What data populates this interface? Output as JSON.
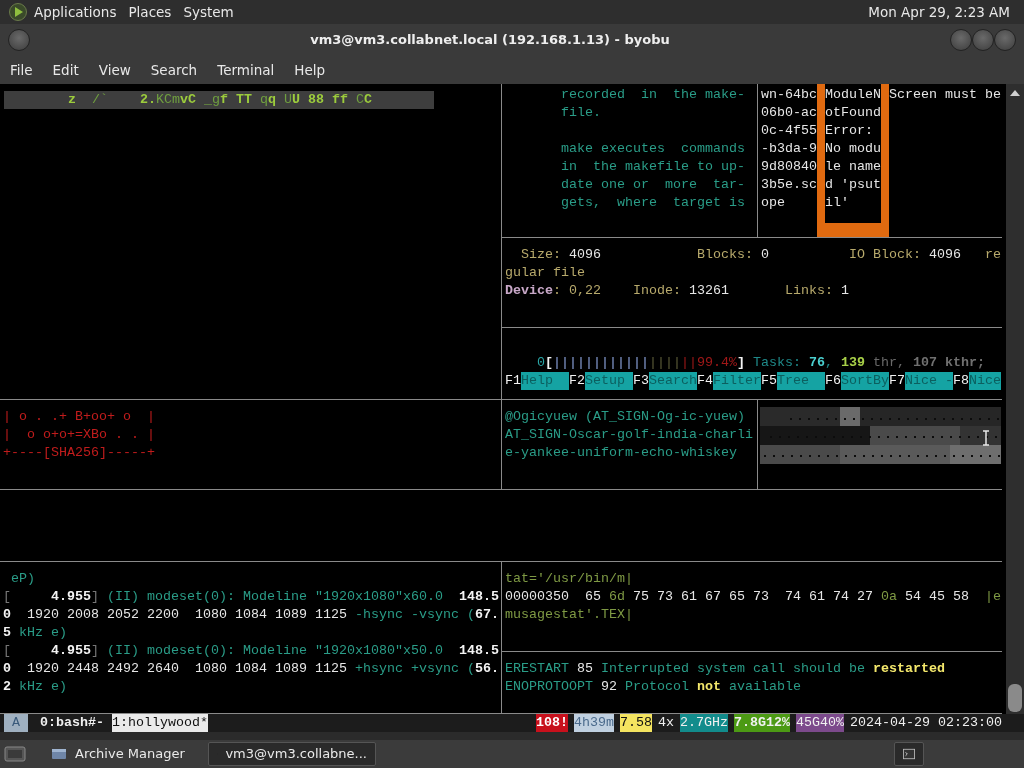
{
  "top_panel": {
    "menus": [
      "Applications",
      "Places",
      "System"
    ],
    "clock": "Mon Apr 29, 2:23 AM"
  },
  "window": {
    "title": "vm3@vm3.collabnet.local (192.168.1.13) - byobu",
    "menu": [
      "File",
      "Edit",
      "View",
      "Search",
      "Terminal",
      "Help"
    ]
  },
  "terminal": {
    "banner": [
      {
        "text": "        z",
        "kind": "bright"
      },
      {
        "text": "  /`",
        "kind": "dim"
      },
      {
        "text": "    2.",
        "kind": "bright"
      },
      {
        "text": "KCm",
        "kind": "dim"
      },
      {
        "text": "vC ",
        "kind": "bright"
      },
      {
        "text": "_g",
        "kind": "dim"
      },
      {
        "text": "f TT ",
        "kind": "bright"
      },
      {
        "text": "q",
        "kind": "dim"
      },
      {
        "text": "q ",
        "kind": "bright"
      },
      {
        "text": "U",
        "kind": "dim"
      },
      {
        "text": "U 88 ff ",
        "kind": "bright"
      },
      {
        "text": "C",
        "kind": "dim"
      },
      {
        "text": "C",
        "kind": "bright"
      }
    ],
    "manual": [
      [
        [
          {
            "text": "recorded  in  the make-",
            "kind": "teal"
          }
        ],
        [
          {
            "text": "file.",
            "kind": "teal"
          }
        ]
      ],
      [
        [
          {
            "text": "make executes  commands",
            "kind": "teal"
          }
        ],
        [
          {
            "text": "in  the makefile to up-",
            "kind": "teal"
          }
        ],
        [
          {
            "text": "date one or  more  tar-",
            "kind": "teal"
          }
        ],
        [
          {
            "text": "gets,  where  target is",
            "kind": "teal"
          }
        ]
      ]
    ],
    "uuid": [
      [
        {
          "text": "wn-64bc",
          "kind": "white"
        }
      ],
      [
        {
          "text": "06b0-ac",
          "kind": "white"
        }
      ],
      [
        {
          "text": "0c-4f55",
          "kind": "white"
        }
      ],
      [
        {
          "text": "-b3da-9",
          "kind": "white"
        }
      ],
      [
        {
          "text": "9d80840",
          "kind": "white"
        }
      ],
      [
        {
          "text": "3b5e.sc",
          "kind": "white"
        }
      ],
      [
        {
          "text": "ope",
          "kind": "white"
        }
      ]
    ],
    "error_box": {
      "color": "#e06a10",
      "lines": [
        [
          {
            "text": "ModuleN",
            "kind": "white"
          }
        ],
        [
          {
            "text": "otFound",
            "kind": "white"
          }
        ],
        [
          {
            "text": "Error:",
            "kind": "white"
          }
        ],
        [
          {
            "text": "No modu",
            "kind": "white"
          }
        ],
        [
          {
            "text": "le name",
            "kind": "white"
          }
        ],
        [
          {
            "text": "d 'psut",
            "kind": "white"
          }
        ],
        [
          {
            "text": "il'",
            "kind": "white"
          }
        ]
      ]
    },
    "notice": [
      [
        {
          "text": "Screen must be",
          "kind": "white"
        }
      ]
    ],
    "stat": [
      [
        {
          "text": "  Size: ",
          "kind": "khaki"
        },
        {
          "text": "4096",
          "kind": "white"
        },
        {
          "text": "            Blocks: ",
          "kind": "khaki"
        },
        {
          "text": "0",
          "kind": "white"
        },
        {
          "text": "          IO Block: ",
          "kind": "khaki"
        },
        {
          "text": "4096",
          "kind": "white"
        },
        {
          "text": "   re",
          "kind": "khaki"
        }
      ],
      [
        {
          "text": "gular file",
          "kind": "khaki"
        }
      ],
      [
        {
          "text": "Device",
          "kind": "label"
        },
        {
          "text": ": 0,22    Inode: ",
          "kind": "khaki"
        },
        {
          "text": "13261",
          "kind": "white"
        },
        {
          "text": "       Links: ",
          "kind": "khaki"
        },
        {
          "text": "1",
          "kind": "white"
        }
      ]
    ],
    "htop_meter": [
      {
        "text": "    0",
        "kind": "cyan"
      },
      {
        "text": "[",
        "kind": "strong"
      },
      {
        "text": "||||||||||||",
        "kind": "bluebar"
      },
      {
        "text": "||||",
        "kind": "olivebar"
      },
      {
        "text": "||",
        "kind": "redbar"
      },
      {
        "text": "99.4%",
        "kind": "redbar"
      },
      {
        "text": "]",
        "kind": "strong"
      },
      {
        "text": " Tasks: ",
        "kind": "tasks"
      },
      {
        "text": "76",
        "kind": "count"
      },
      {
        "text": ", ",
        "kind": "tasks"
      },
      {
        "text": "139",
        "kind": "threads"
      },
      {
        "text": " thr, ",
        "kind": "muted"
      },
      {
        "text": "107 kthr;",
        "kind": "mutedbold"
      }
    ],
    "function_keys": [
      {
        "key": "F1",
        "label": "Help  "
      },
      {
        "key": "F2",
        "label": "Setup "
      },
      {
        "key": "F3",
        "label": "Search"
      },
      {
        "key": "F4",
        "label": "Filter"
      },
      {
        "key": "F5",
        "label": "Tree  "
      },
      {
        "key": "F6",
        "label": "SortBy"
      },
      {
        "key": "F7",
        "label": "Nice -"
      },
      {
        "key": "F8",
        "label": "Nice"
      }
    ],
    "key_art": [
      [
        {
          "text": "| o . .+ B+oo+ o  |",
          "kind": "red"
        }
      ],
      [
        {
          "text": "|  o o+o+=XBo . . |",
          "kind": "red"
        }
      ],
      [
        {
          "text": "+----[SHA256]-----+",
          "kind": "red"
        }
      ]
    ],
    "nato": [
      [
        {
          "text": "@Ogicyuew (AT_SIGN-Og-ic-yuew)",
          "kind": "teal"
        }
      ],
      [
        {
          "text": "AT_SIGN-Oscar-golf-india-charli",
          "kind": "teal"
        }
      ],
      [
        {
          "text": "e-yankee-uniform-echo-whiskey",
          "kind": "teal"
        }
      ]
    ],
    "image_area": {
      "kind": "picture"
    },
    "dmesg": [
      [
        {
          "text": " eP)",
          "kind": "teal"
        }
      ],
      [
        {
          "text": "[",
          "kind": "gray"
        },
        {
          "text": "     4.955",
          "kind": "strong"
        },
        {
          "text": "]",
          "kind": "gray"
        },
        {
          "text": " (II) modeset(0): Modeline \"1920x1080\"x60.0  ",
          "kind": "teal"
        },
        {
          "text": "148.5",
          "kind": "strong"
        }
      ],
      [
        {
          "text": "0",
          "kind": "strong"
        },
        {
          "text": "  1920 2008 2052 2200  1080 1084 1089 1125 ",
          "kind": "white"
        },
        {
          "text": "-hsync -vsync (",
          "kind": "teal"
        },
        {
          "text": "67.",
          "kind": "strong"
        }
      ],
      [
        {
          "text": "5",
          "kind": "strong"
        },
        {
          "text": " kHz e)",
          "kind": "teal"
        }
      ],
      [
        {
          "text": "[",
          "kind": "gray"
        },
        {
          "text": "     4.955",
          "kind": "strong"
        },
        {
          "text": "]",
          "kind": "gray"
        },
        {
          "text": " (II) modeset(0): Modeline \"1920x1080\"x50.0  ",
          "kind": "teal"
        },
        {
          "text": "148.5",
          "kind": "strong"
        }
      ],
      [
        {
          "text": "0",
          "kind": "strong"
        },
        {
          "text": "  1920 2448 2492 2640  1080 1084 1089 1125 ",
          "kind": "white"
        },
        {
          "text": "+hsync +vsync (",
          "kind": "teal"
        },
        {
          "text": "56.",
          "kind": "strong"
        }
      ],
      [
        {
          "text": "2",
          "kind": "strong"
        },
        {
          "text": " kHz e)",
          "kind": "teal"
        }
      ]
    ],
    "hexdump": [
      [
        {
          "text": "tat='/usr/bin/m|",
          "kind": "olive"
        }
      ],
      [
        {
          "text": "00000350  65 ",
          "kind": "white"
        },
        {
          "text": "6d",
          "kind": "olive"
        },
        {
          "text": " 75 73 61 67 65 73  74 61 74 27 ",
          "kind": "white"
        },
        {
          "text": "0a",
          "kind": "olive"
        },
        {
          "text": " 54 45 58  ",
          "kind": "white"
        },
        {
          "text": "|e",
          "kind": "olive"
        }
      ],
      [
        {
          "text": "musagestat'.TEX|",
          "kind": "olive"
        }
      ]
    ],
    "errno": [
      [
        {
          "text": "ERESTART",
          "kind": "teal"
        },
        {
          "text": " 85 ",
          "kind": "white"
        },
        {
          "text": "Interrupted system call should be ",
          "kind": "teal"
        },
        {
          "text": "restarted",
          "kind": "highlight"
        }
      ],
      [
        {
          "text": "ENOPROTOOPT",
          "kind": "teal"
        },
        {
          "text": " 92 ",
          "kind": "white"
        },
        {
          "text": "Protocol ",
          "kind": "teal"
        },
        {
          "text": "not",
          "kind": "highlight"
        },
        {
          "text": " available",
          "kind": "teal"
        }
      ]
    ]
  },
  "status_bar": {
    "session": "A",
    "windows": [
      {
        "label": "0:bash#-",
        "selected": false
      },
      {
        "label": "1:hollywood*",
        "selected": true
      }
    ],
    "indicators": [
      {
        "text": "108!",
        "kind": "alert"
      },
      {
        "text": "4h39m",
        "kind": "uptime"
      },
      {
        "text": "7.58",
        "kind": "load"
      },
      {
        "text": "4x",
        "kind": "plain"
      },
      {
        "text": "2.7GHz",
        "kind": "cpu"
      },
      {
        "text": "7.8G12%",
        "kind": "memory"
      },
      {
        "text": "45G40%",
        "kind": "disk"
      },
      {
        "text": "2024-04-29 02:23:00",
        "kind": "plain"
      }
    ]
  },
  "taskbar": [
    {
      "label": "Archive Manager",
      "selected": false,
      "kind": "archive"
    },
    {
      "label": "vm3@vm3.collabne...",
      "selected": true,
      "kind": "terminal"
    }
  ]
}
